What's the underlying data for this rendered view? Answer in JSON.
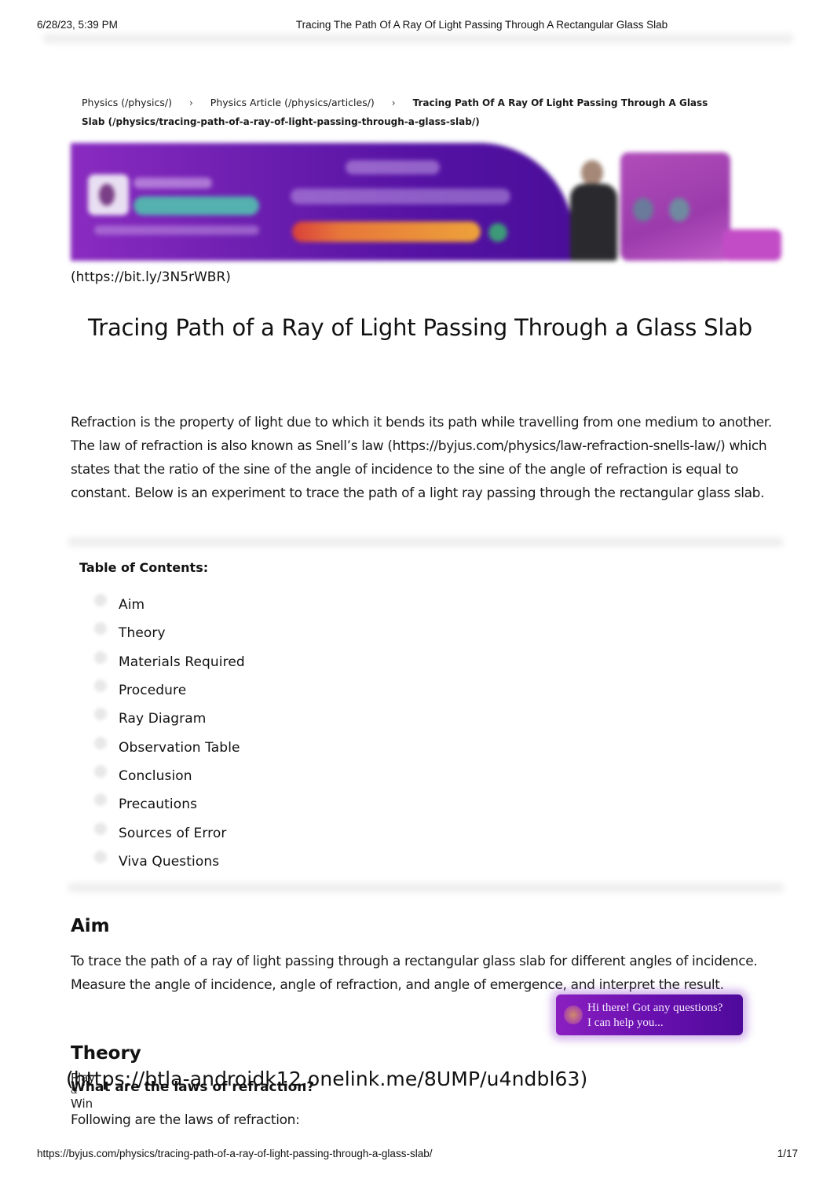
{
  "print_header": {
    "date": "6/28/23, 5:39 PM",
    "title": "Tracing The Path Of A Ray Of Light Passing Through A Rectangular Glass Slab"
  },
  "breadcrumb": {
    "items": [
      {
        "label": "Physics (/physics/)"
      },
      {
        "label": "Physics Article (/physics/articles/)"
      },
      {
        "label": "Tracing Path Of A Ray Of Light Passing Through A Glass Slab (/physics/tracing-path-of-a-ray-of-light-passing-through-a-glass-slab/)"
      }
    ],
    "separator": "›"
  },
  "banner": {
    "link_text": "(https://bit.ly/3N5rWBR)",
    "colors": {
      "primary": "#6d1fb0",
      "accent_teal": "#55b0b0",
      "cta": "#e7763a"
    }
  },
  "article": {
    "title": "Tracing Path of a Ray of Light Passing Through a Glass Slab",
    "intro": "Refraction is the property of light due to which it bends its path while travelling from one medium to another. The law of refraction is also known as Snell’s law (https://byjus.com/physics/law-refraction-snells-law/) which states that the ratio of the sine of the angle of incidence to the sine of the angle of refraction is equal to constant. Below is an experiment to trace the path of a light ray passing through the rectangular glass slab."
  },
  "toc": {
    "title": "Table of Contents:",
    "items": [
      {
        "label": "Aim"
      },
      {
        "label": "Theory"
      },
      {
        "label": "Materials Required"
      },
      {
        "label": "Procedure"
      },
      {
        "label": "Ray Diagram"
      },
      {
        "label": "Observation Table"
      },
      {
        "label": "Conclusion"
      },
      {
        "label": "Precautions"
      },
      {
        "label": "Sources of Error"
      },
      {
        "label": "Viva Questions"
      }
    ]
  },
  "aim": {
    "heading": "Aim",
    "body": "To trace the path of a ray of light passing through a rectangular glass slab for different angles of incidence. Measure the angle of incidence, angle of refraction, and angle of emergence, and interpret the result."
  },
  "theory": {
    "heading": "Theory",
    "question": "What are the laws of refraction?",
    "intro": "Following are the laws of refraction:"
  },
  "play_win": {
    "line1": "Play",
    "line2": "&",
    "line3": "Win",
    "link_text": "(https://btla-androidk12.onelink.me/8UMP/u4ndbl63)"
  },
  "chat": {
    "line1": "Hi there! Got any questions?",
    "line2": "I can help you...",
    "color": "#6a10b0"
  },
  "print_footer": {
    "url": "https://byjus.com/physics/tracing-path-of-a-ray-of-light-passing-through-a-glass-slab/",
    "page": "1/17"
  }
}
